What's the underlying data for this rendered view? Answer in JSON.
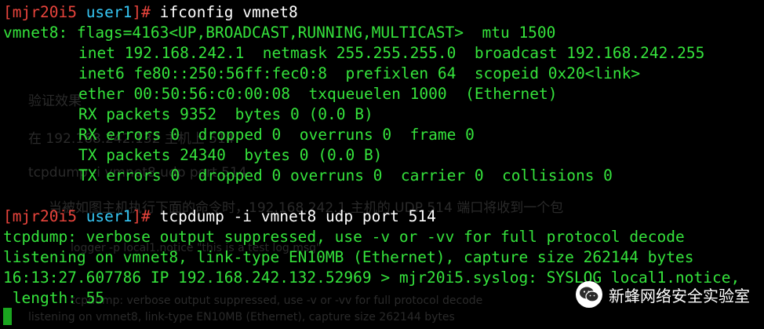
{
  "prompt": {
    "open": "[",
    "host": "mjr20i5",
    "user": "user1",
    "close": "]#"
  },
  "commands": [
    "ifconfig vmnet8",
    "tcpdump -i vmnet8 udp port 514"
  ],
  "ifconfig": [
    "vmnet8: flags=4163<UP,BROADCAST,RUNNING,MULTICAST>  mtu 1500",
    "inet 192.168.242.1  netmask 255.255.255.0  broadcast 192.168.242.255",
    "inet6 fe80::250:56ff:fec0:8  prefixlen 64  scopeid 0x20<link>",
    "ether 00:50:56:c0:00:08  txqueuelen 1000  (Ethernet)",
    "RX packets 9352  bytes 0 (0.0 B)",
    "RX errors 0  dropped 0  overruns 0  frame 0",
    "TX packets 24340  bytes 0 (0.0 B)",
    "TX errors 0  dropped 0 overruns 0  carrier 0  collisions 0"
  ],
  "tcpdump": [
    "tcpdump: verbose output suppressed, use -v or -vv for full protocol decode",
    "listening on vmnet8, link-type EN10MB (Ethernet), capture size 262144 bytes",
    "16:13:27.607786 IP 192.168.242.132.52969 > mjr20i5.syslog: SYSLOG local1.notice,",
    " length: 55"
  ],
  "background_text": [
    "验证效果",
    "在 192.168.242.132 主机上 514",
    "tcpdump -i vmnet8 udp port 514",
    "当被如图主机执行下面的命令时，192.168.242.1 主机的 UDP 514 端口将收到一个包",
    "logger -p local1.notice \"this is a test log msg\"",
    "tcpdump: verbose output suppressed, use -v or -vv for full protocol decode",
    "listening on vmnet8, link-type EN10MB (Ethernet), capture size 262144 bytes"
  ],
  "watermark": {
    "text": "新蜂网络安全实验室",
    "icon": "wechat-icon"
  },
  "colors": {
    "green": "#35e33c",
    "red": "#e8443c",
    "cyan": "#36c6f4",
    "background": "#000000"
  }
}
